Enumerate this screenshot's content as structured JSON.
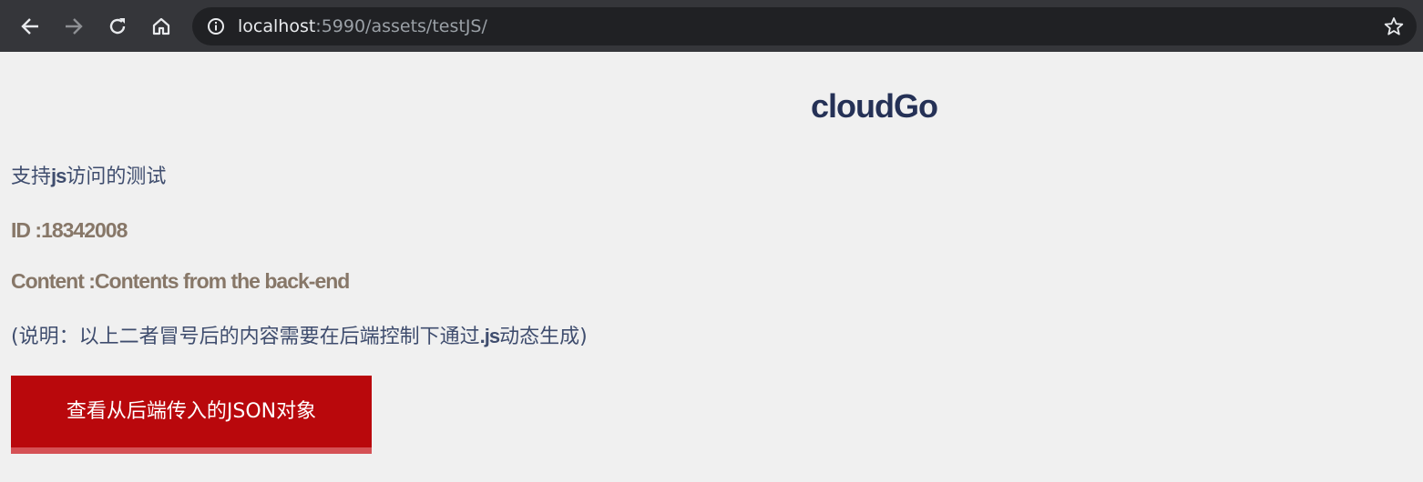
{
  "browser": {
    "url_host": "localhost",
    "url_rest": ":5990/assets/testJS/",
    "icons": {
      "back": "arrow-left-icon",
      "forward": "arrow-right-icon",
      "reload": "reload-icon",
      "home": "home-icon",
      "info": "info-icon",
      "bookmark": "star-icon"
    }
  },
  "page": {
    "title": "cloudGo",
    "intro_prefix": "支持",
    "intro_js": "js",
    "intro_suffix": "访问的测试",
    "id_label": "ID :",
    "id_value": "18342008",
    "content_label": "Content :",
    "content_value": "Contents from the back-end",
    "note_prefix": "(说明：以上二者冒号后的内容需要在后端控制下通过",
    "note_js": ".js",
    "note_suffix": "动态生成)",
    "button_label": "查看从后端传入的JSON对象"
  },
  "colors": {
    "title": "#253156",
    "text": "#3f4d6e",
    "field": "#877768",
    "button": "#b9080c",
    "button_shadow": "#d55155",
    "background": "#f0f0f0",
    "toolbar": "#35363a"
  }
}
